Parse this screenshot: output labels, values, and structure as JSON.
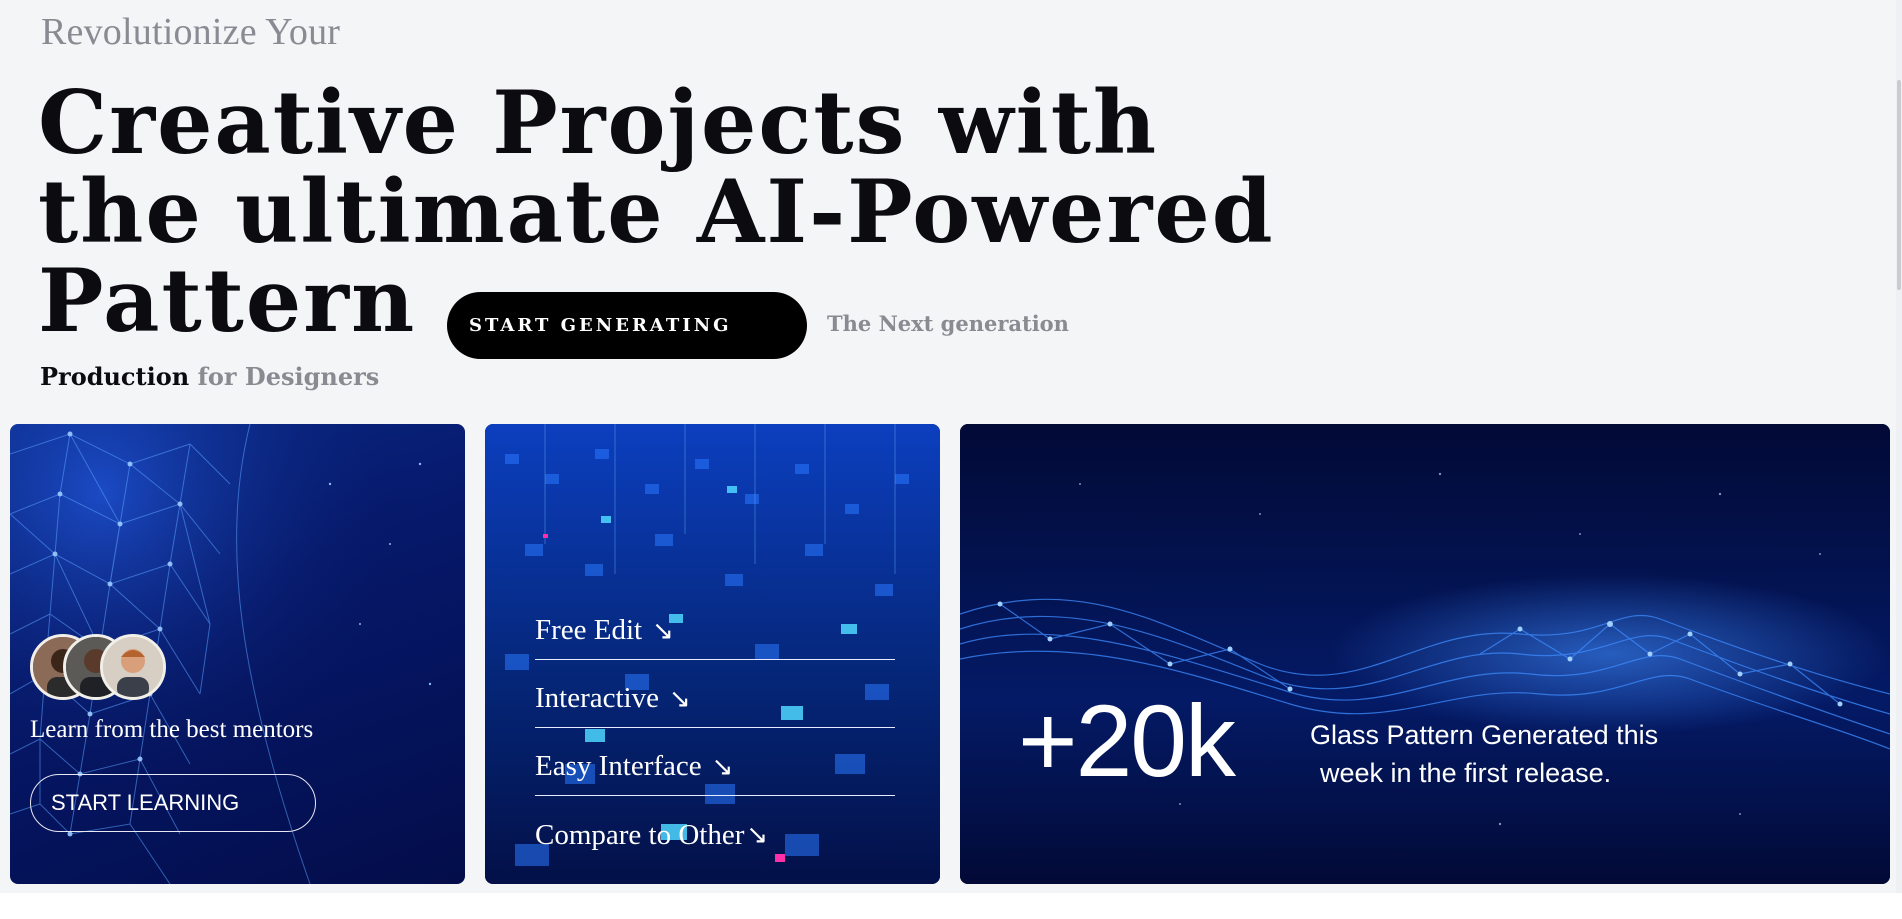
{
  "hero": {
    "eyebrow": "Revolutionize Your",
    "headline_lines": [
      "Creative Projects with",
      "the ultimate AI-Powered",
      "Pattern"
    ],
    "cta_label": "START GENERATING",
    "tagline": "The Next generation",
    "subline_strong": "Production",
    "subline_muted": "for Designers"
  },
  "cards": {
    "mentors": {
      "text": "Learn from the best mentors",
      "button_label": "START LEARNING"
    },
    "features": {
      "items": [
        {
          "label": "Free Edit",
          "icon": "arrow-down-right-icon",
          "arrow": "↘"
        },
        {
          "label": "Interactive",
          "icon": "arrow-down-right-icon",
          "arrow": "↘"
        },
        {
          "label": "Easy Interface",
          "icon": "arrow-down-right-icon",
          "arrow": "↘"
        },
        {
          "label": "Compare to Other",
          "icon": "arrow-down-right-icon",
          "arrow": "↘"
        }
      ]
    },
    "stats": {
      "number": "+20k",
      "text_line1": "Glass Pattern Generated this",
      "text_line2": "week in the first release."
    }
  },
  "colors": {
    "background": "#f4f5f7",
    "text_dark": "#0b0b10",
    "text_muted": "#8a8a92",
    "cta_bg": "#000000",
    "card_navy": "#031048",
    "accent_blue": "#2f7bff"
  }
}
